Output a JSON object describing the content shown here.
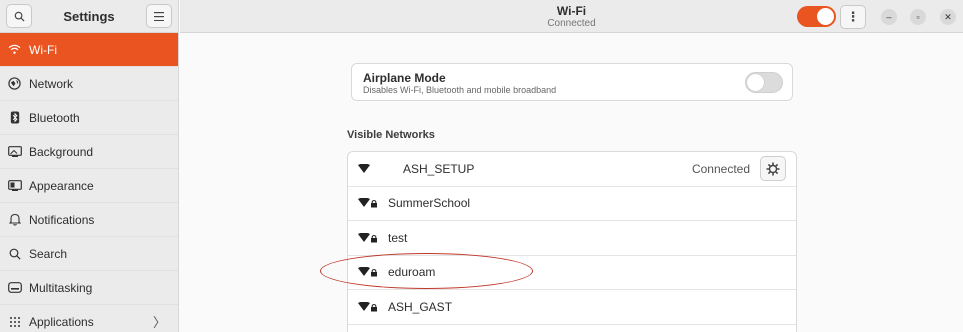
{
  "sidebar": {
    "title": "Settings",
    "items": [
      {
        "label": "Wi-Fi",
        "icon": "wifi-icon",
        "active": true
      },
      {
        "label": "Network",
        "icon": "network-icon"
      },
      {
        "label": "Bluetooth",
        "icon": "bluetooth-icon"
      },
      {
        "label": "Background",
        "icon": "background-icon"
      },
      {
        "label": "Appearance",
        "icon": "appearance-icon"
      },
      {
        "label": "Notifications",
        "icon": "bell-icon"
      },
      {
        "label": "Search",
        "icon": "search-icon"
      },
      {
        "label": "Multitasking",
        "icon": "multitasking-icon"
      },
      {
        "label": "Applications",
        "icon": "applications-icon"
      }
    ]
  },
  "header": {
    "title": "Wi-Fi",
    "subtitle": "Connected",
    "wifi_enabled": true
  },
  "airplane": {
    "title": "Airplane Mode",
    "description": "Disables Wi-Fi, Bluetooth and mobile broadband",
    "enabled": false
  },
  "networks": {
    "section_label": "Visible Networks",
    "items": [
      {
        "name": "ASH_SETUP",
        "status": "Connected",
        "secured": false
      },
      {
        "name": "SummerSchool",
        "secured": true
      },
      {
        "name": "test",
        "secured": true
      },
      {
        "name": "eduroam",
        "secured": true
      },
      {
        "name": "ASH_GAST",
        "secured": true
      }
    ]
  },
  "colors": {
    "accent": "#e95420",
    "annotation": "#c0392b"
  }
}
